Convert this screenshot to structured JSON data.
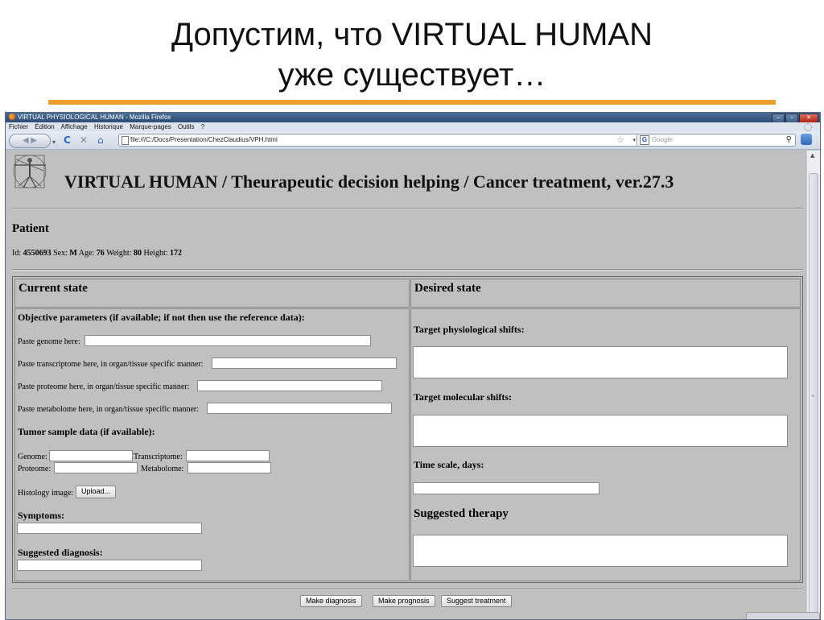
{
  "slide": {
    "title_line1": "Допустим, что VIRTUAL HUMAN",
    "title_line2": "уже существует…",
    "accent_color": "#f0a030"
  },
  "browser": {
    "window_title": "VIRTUAL PHYSIOLOGICAL HUMAN - Mozilla Firefox",
    "menu": [
      "Fichier",
      "Édition",
      "Affichage",
      "Historique",
      "Marque-pages",
      "Outils",
      "?"
    ],
    "url": "file:///C:/Docs/Presentation/ChezClaudius/VPH.html",
    "search_placeholder": "Google",
    "search_engine_icon": "G",
    "icons": {
      "back": "back-icon",
      "reload": "reload-icon",
      "stop": "stop-icon",
      "home": "home-icon",
      "bookmark": "star-icon",
      "search": "magnifier-icon"
    }
  },
  "app": {
    "title": "VIRTUAL HUMAN / Theurapeutic decision helping / Cancer treatment, ver.27.3",
    "patient_heading": "Patient",
    "patient": {
      "id_label": "Id:",
      "id": "4550693",
      "sex_label": "Sex:",
      "sex": "M",
      "age_label": "Age:",
      "age": "76",
      "weight_label": "Weight:",
      "weight": "80",
      "height_label": "Height:",
      "height": "172"
    },
    "current_state": {
      "header": "Current state",
      "objective_heading": "Objective parameters (if available; if not then use the reference data):",
      "genome_label": "Paste genome here:",
      "transcriptome_label": "Paste transcriptome here, in organ/tissue specific manner:",
      "proteome_label": "Paste proteome here, in organ/tissue specific manner:",
      "metabolome_label": "Paste metabolome here, in organ/tissue specific manner:",
      "tumor_heading": "Tumor sample data (if available):",
      "tumor_genome_label": "Genome:",
      "tumor_transcriptome_label": "Transcriptome:",
      "tumor_proteome_label": "Proteome:",
      "tumor_metabolome_label": "Metabolome:",
      "histology_label": "Histology image:",
      "upload_button": "Upload...",
      "symptoms_heading": "Symptoms:",
      "diagnosis_heading": "Suggested diagnosis:"
    },
    "desired_state": {
      "header": "Desired state",
      "physio_heading": "Target physiological shifts:",
      "molecular_heading": "Target molecular shifts:",
      "timescale_heading": "Time scale, days:",
      "therapy_heading": "Suggested therapy"
    },
    "actions": {
      "diagnosis": "Make diagnosis",
      "prognosis": "Make prognosis",
      "treatment": "Suggest treatment"
    }
  }
}
